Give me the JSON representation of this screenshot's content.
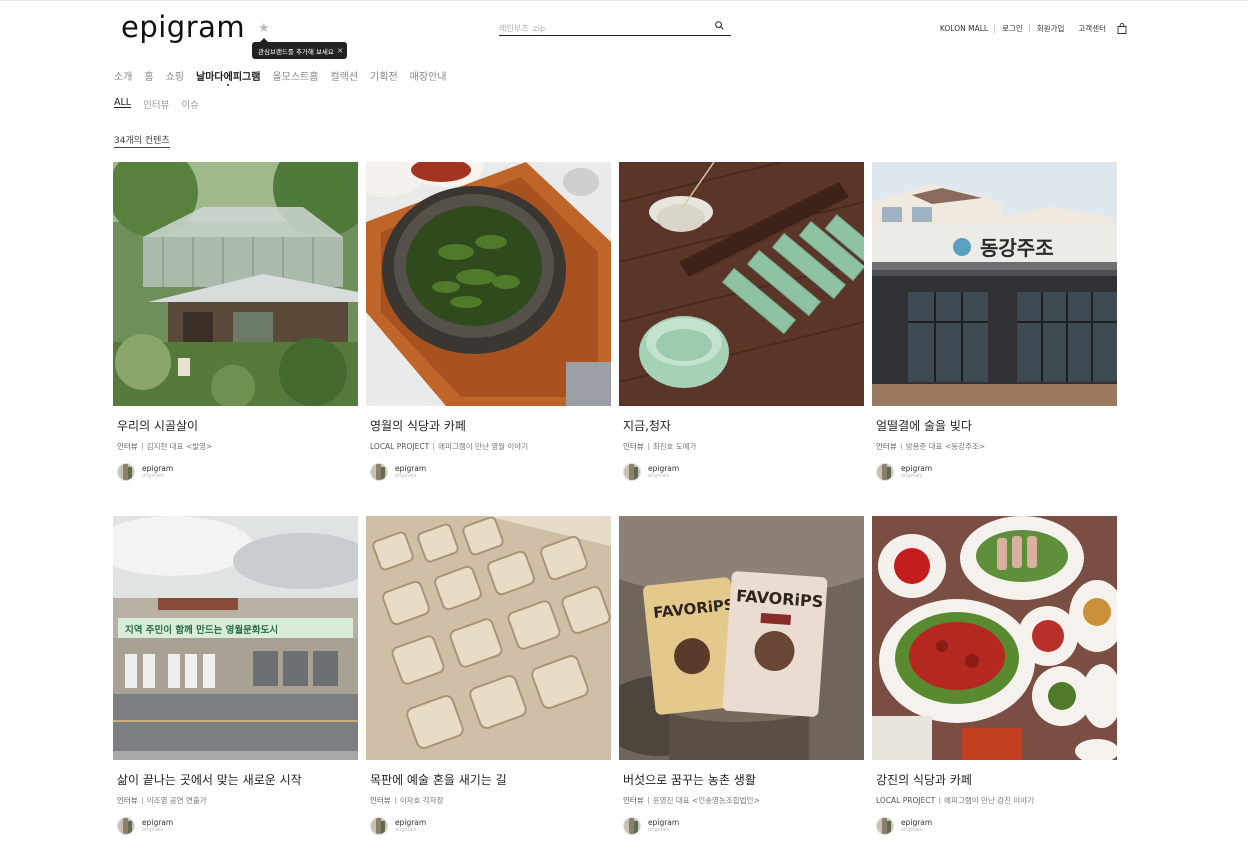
{
  "brand": {
    "logo": "epigram",
    "star": "★"
  },
  "tooltip": {
    "text": "관심브랜드를 추가해 보세요",
    "close": "×"
  },
  "search": {
    "placeholder": "레인부츠 .zip"
  },
  "util_nav": [
    "KOLON MALL",
    "로그인",
    "회원가입",
    "고객센터"
  ],
  "gnb": [
    {
      "label": "소개",
      "active": false
    },
    {
      "label": "홈",
      "active": false
    },
    {
      "label": "쇼핑",
      "active": false
    },
    {
      "label": "날마다에피그램",
      "active": true
    },
    {
      "label": "올모스트홈",
      "active": false
    },
    {
      "label": "컬렉션",
      "active": false
    },
    {
      "label": "기획전",
      "active": false
    },
    {
      "label": "매장안내",
      "active": false
    }
  ],
  "subnav": [
    {
      "label": "ALL",
      "active": true
    },
    {
      "label": "인터뷰",
      "active": false
    },
    {
      "label": "이슈",
      "active": false
    }
  ],
  "content_count": "34개의 컨텐츠",
  "cards": [
    {
      "title": "우리의 시골살이",
      "category": "인터뷰",
      "subtitle": "김지현 대표 <발영>",
      "author": "epigram",
      "author_sub": "originals",
      "image": "greenhouse"
    },
    {
      "title": "영월의 식당과 카페",
      "category": "LOCAL PROJECT",
      "subtitle": "에피그램이 만난 영월 이야기",
      "author": "epigram",
      "author_sub": "originals",
      "image": "stone-pot-greens"
    },
    {
      "title": "지금,청자",
      "category": "인터뷰",
      "subtitle": "최진호 도예가",
      "author": "epigram",
      "author_sub": "originals",
      "image": "celadon"
    },
    {
      "title": "얼떨결에 술을 빚다",
      "category": "인터뷰",
      "subtitle": "방용준 대표 <동강주조>",
      "author": "epigram",
      "author_sub": "originals",
      "image": "brewery",
      "sign": "동강주조"
    },
    {
      "title": "삶이 끝나는 곳에서 맞는 새로운 시작",
      "category": "인터뷰",
      "subtitle": "이조영 공연 연출가",
      "author": "epigram",
      "author_sub": "originals",
      "image": "old-building",
      "sign": "지역 주민이 함께 만드는 영월문화도시"
    },
    {
      "title": "목판에 예술 혼을 새기는 길",
      "category": "인터뷰",
      "subtitle": "이자호 각자장",
      "author": "epigram",
      "author_sub": "originals",
      "image": "woodblock"
    },
    {
      "title": "버섯으로 꿈꾸는 농촌 생활",
      "category": "인터뷰",
      "subtitle": "윤영진 대표 <인송영농조합법인>",
      "author": "epigram",
      "author_sub": "originals",
      "image": "mushroom-snack",
      "brand_text": "FAVORiPS"
    },
    {
      "title": "강진의 식당과 카페",
      "category": "LOCAL PROJECT",
      "subtitle": "에피그램이 만난 강진 이야기",
      "author": "epigram",
      "author_sub": "originals",
      "image": "korean-table"
    }
  ]
}
